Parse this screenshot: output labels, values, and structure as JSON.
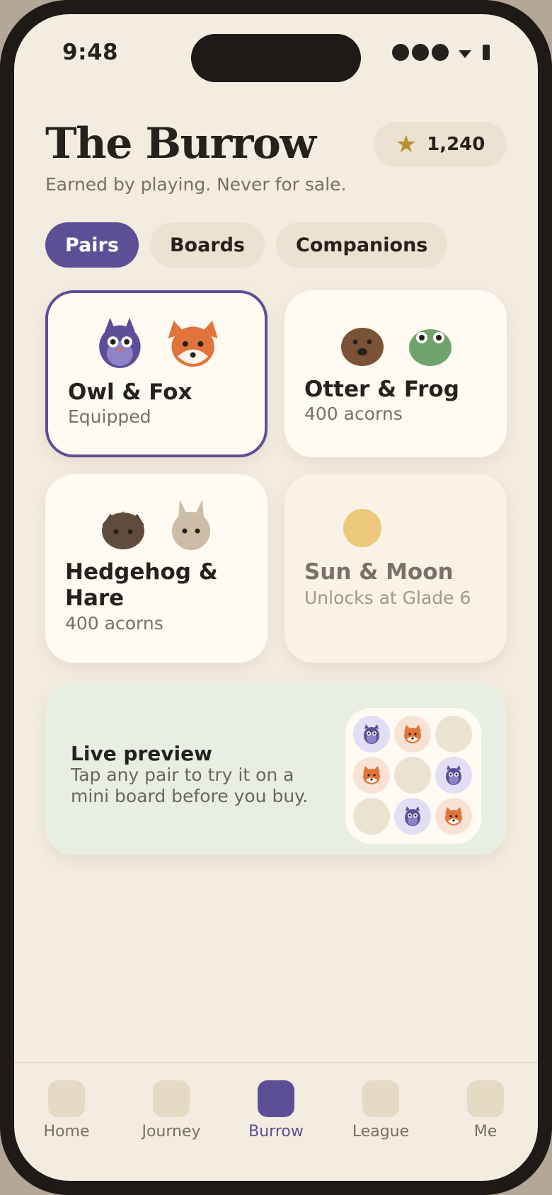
{
  "status_bar": {
    "time": "9:48"
  },
  "header": {
    "title": "The Burrow",
    "subtitle": "Earned by playing. Never for sale.",
    "acorns": {
      "icon": "star-icon",
      "count": "1,240"
    }
  },
  "tabs": [
    {
      "label": "Pairs",
      "active": true
    },
    {
      "label": "Boards",
      "active": false
    },
    {
      "label": "Companions",
      "active": false
    }
  ],
  "pairs": [
    {
      "name": "Owl & Fox",
      "status": "Equipped",
      "state": "equipped",
      "icons": [
        "owl-icon",
        "fox-icon"
      ]
    },
    {
      "name": "Otter & Frog",
      "status": "400 acorns",
      "state": "available",
      "icons": [
        "otter-icon",
        "frog-icon"
      ]
    },
    {
      "name": "Hedgehog & Hare",
      "status": "400 acorns",
      "state": "available",
      "icons": [
        "hedgehog-icon",
        "hare-icon"
      ]
    },
    {
      "name": "Sun & Moon",
      "status": "Unlocks at Glade 6",
      "state": "locked",
      "icons": [
        "sun-icon"
      ]
    }
  ],
  "preview": {
    "title": "Live preview",
    "description": "Tap any pair to try it on a mini board before you buy.",
    "mini_board": [
      "owl",
      "fox",
      "empty",
      "fox",
      "empty",
      "owl",
      "empty",
      "owl",
      "fox"
    ]
  },
  "nav": [
    {
      "label": "Home",
      "active": false
    },
    {
      "label": "Journey",
      "active": false
    },
    {
      "label": "Burrow",
      "active": true
    },
    {
      "label": "League",
      "active": false
    },
    {
      "label": "Me",
      "active": false
    }
  ],
  "colors": {
    "accent": "#5c4f96",
    "background": "#f3ece0",
    "card": "#fffbf3",
    "fox": "#e0743a",
    "owl": "#5c4f96",
    "otter": "#7a5236",
    "frog": "#6fa36b",
    "sun": "#ebc87a"
  }
}
